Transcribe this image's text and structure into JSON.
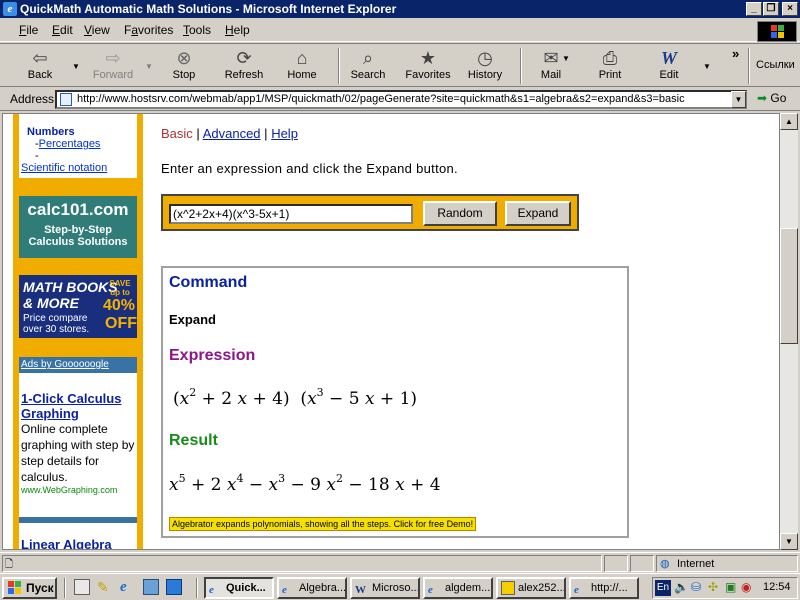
{
  "window": {
    "title": "QuickMath Automatic Math Solutions - Microsoft Internet Explorer"
  },
  "menu": [
    {
      "label": "File",
      "u": "F",
      "rest": "ile"
    },
    {
      "label": "Edit",
      "u": "E",
      "rest": "dit"
    },
    {
      "label": "View",
      "u": "V",
      "rest": "iew"
    },
    {
      "label": "Favorites",
      "u": "a",
      "pre": "F",
      "rest": "vorites"
    },
    {
      "label": "Tools",
      "u": "T",
      "rest": "ools"
    },
    {
      "label": "Help",
      "u": "H",
      "rest": "elp"
    }
  ],
  "toolbar": {
    "back": "Back",
    "forward": "Forward",
    "stop": "Stop",
    "refresh": "Refresh",
    "home": "Home",
    "search": "Search",
    "favorites": "Favorites",
    "history": "History",
    "mail": "Mail",
    "print": "Print",
    "edit": "Edit",
    "links": "Ссылки",
    "more": "»"
  },
  "address": {
    "label": "Address",
    "url": "http://www.hostsrv.com/webmab/app1/MSP/quickmath/02/pageGenerate?site=quickmath&s1=algebra&s2=expand&s3=basic",
    "go": "Go"
  },
  "sidebar": {
    "numbers_heading": "Numbers",
    "links": [
      "Percentages",
      "",
      "Scientific notation"
    ],
    "calc_title": "calc101.com",
    "calc_sub1": "Step-by-Step",
    "calc_sub2": "Calculus Solutions",
    "books_title1": "MATH BOOKS",
    "books_title2": "& MORE",
    "books_save": "SAVE",
    "books_upto": "up to",
    "books_pct": "40%",
    "books_off": "OFF",
    "books_sub1": "Price compare",
    "books_sub2": "over 30 stores.",
    "ads_header": "Ads by Goooooogle",
    "ad1_title": "1-Click Calculus Graphing",
    "ad1_text": "Online complete graphing with step by step details for calculus.",
    "ad1_url": "www.WebGraphing.com",
    "ad2_title": "Linear Algebra"
  },
  "nav": {
    "basic": "Basic",
    "sep": "|",
    "advanced": "Advanced",
    "help": "Help"
  },
  "instruction": "Enter an expression and click the Expand button.",
  "input": {
    "value": "(x^2+2x+4)(x^3-5x+1)"
  },
  "buttons": {
    "random": "Random",
    "expand": "Expand"
  },
  "result": {
    "command_heading": "Command",
    "command_value": "Expand",
    "expression_heading": "Expression",
    "result_heading": "Result",
    "banner": "Algebrator expands polynomials, showing all the steps. Click for free Demo!",
    "colors": {
      "command": "#0a22a0",
      "expression": "#8b158b",
      "result": "#1a8a1a"
    }
  },
  "status": {
    "zone": "Internet"
  },
  "taskbar": {
    "start": "Пуск",
    "tasks": [
      "Quick...",
      "Algebra...",
      "Microso...",
      "algdem...",
      "alex252...",
      "http://..."
    ],
    "lang": "En",
    "clock": "12:54"
  }
}
